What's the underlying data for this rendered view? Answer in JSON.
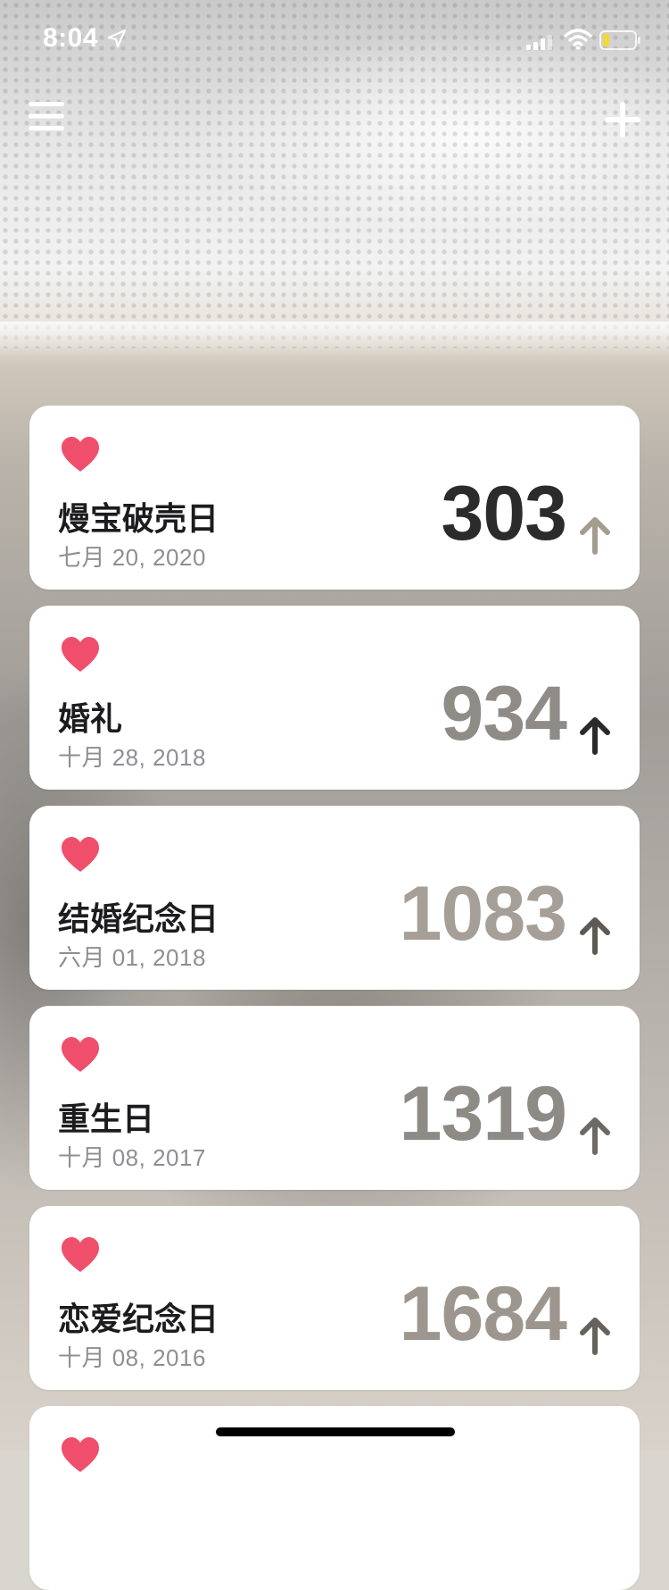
{
  "status_bar": {
    "time": "8:04"
  },
  "top_bar": {
    "menu_icon": "menu-icon",
    "add_icon": "plus-icon"
  },
  "events": [
    {
      "title": "熳宝破壳日",
      "date": "七月 20, 2020",
      "days": "303"
    },
    {
      "title": "婚礼",
      "date": "十月 28, 2018",
      "days": "934"
    },
    {
      "title": "结婚纪念日",
      "date": "六月 01, 2018",
      "days": "1083"
    },
    {
      "title": "重生日",
      "date": "十月 08, 2017",
      "days": "1319"
    },
    {
      "title": "恋爱纪念日",
      "date": "十月 08, 2016",
      "days": "1684"
    }
  ],
  "colors": {
    "heart": "#ef4f6a",
    "card": "#ffffff"
  }
}
